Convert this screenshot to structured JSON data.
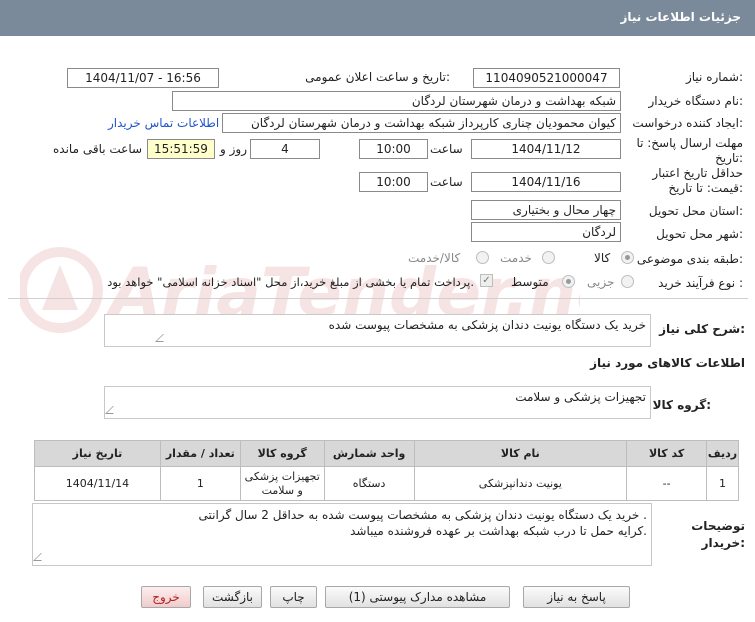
{
  "header": {
    "title": "جزئیات اطلاعات نیاز"
  },
  "fields": {
    "need_number": {
      "label": "شماره نیاز:",
      "value": "1104090521000047"
    },
    "announce_datetime": {
      "label": "تاریخ و ساعت اعلان عمومی:",
      "value": "1404/11/07 - 16:56"
    },
    "buyer_org": {
      "label": "نام دستگاه خریدار:",
      "value": "شبکه بهداشت و درمان شهرستان لردگان"
    },
    "requester": {
      "label": "ایجاد کننده درخواست:",
      "value": "کیوان محمودیان چناری کارپرداز شبکه بهداشت و درمان شهرستان لردگان"
    },
    "contact_link": "اطلاعات تماس خریدار",
    "reply_deadline": {
      "label": "مهلت ارسال پاسخ: تا تاریخ:",
      "date": "1404/11/12",
      "time_label": "ساعت",
      "time": "10:00",
      "days": "4",
      "days_label": "روز و",
      "remaining": "15:51:59",
      "remaining_label": "ساعت باقی مانده"
    },
    "price_validity": {
      "label": "حداقل تاریخ اعتبار قیمت: تا تاریخ:",
      "date": "1404/11/16",
      "time_label": "ساعت",
      "time": "10:00"
    },
    "province": {
      "label": "استان محل تحویل:",
      "value": "چهار محال و بختیاری"
    },
    "city": {
      "label": "شهر محل تحویل:",
      "value": "لردگان"
    },
    "category": {
      "label": "طبقه بندی موضوعی:",
      "options": [
        "کالا",
        "خدمت",
        "کالا/خدمت"
      ],
      "selected": "کالا"
    },
    "process_type": {
      "label": "نوع فرآیند خرید :",
      "options": [
        "جزیی",
        "متوسط"
      ],
      "selected": "متوسط",
      "payment_note": "پرداخت تمام یا بخشی از مبلغ خرید،از محل \"اسناد خزانه اسلامی\" خواهد بود."
    }
  },
  "summary": {
    "label": "شرح کلی نیاز:",
    "value": "خرید یک دستگاه یونیت دندان پزشکی به مشخصات پیوست شده"
  },
  "goods_info": {
    "title": "اطلاعات کالاهای مورد نیاز",
    "group_label": "گروه کالا:",
    "group_value": "تجهیزات پزشکی و سلامت"
  },
  "table": {
    "columns": [
      "ردیف",
      "کد کالا",
      "نام کالا",
      "واحد شمارش",
      "گروه کالا",
      "تعداد / مقدار",
      "تاریخ نیاز"
    ],
    "rows": [
      [
        "1",
        "--",
        "یونیت دندانپزشکی",
        "دستگاه",
        "تجهیزات پزشکی و سلامت",
        "1",
        "1404/11/14"
      ]
    ]
  },
  "buyer_notes": {
    "label": "توضیحات خریدار:",
    "line1": "خرید یک دستگاه یونیت دندان پزشکی به مشخصات پیوست شده  به حداقل 2 سال گرانتی .",
    "line2": "کرایه حمل تا درب شبکه بهداشت بر عهده فروشنده میباشد."
  },
  "buttons": {
    "reply": "پاسخ به نیاز",
    "attachments": "مشاهده مدارک پیوستی (1)",
    "print": "چاپ",
    "back": "بازگشت",
    "exit": "خروج"
  },
  "colors": {
    "header_bg": "#7b8a9a",
    "remaining_bg": "#ffffcc",
    "link": "#2255cc",
    "exit_text": "#b02020"
  }
}
